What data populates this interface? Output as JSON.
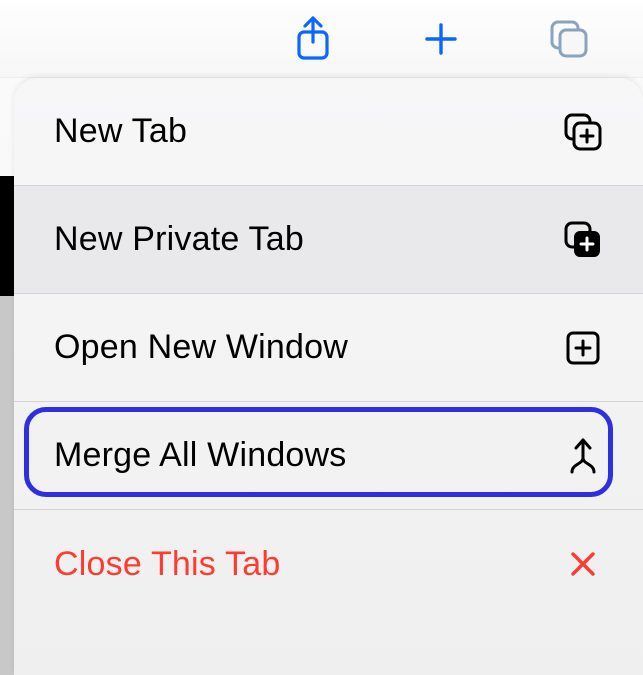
{
  "toolbar": {
    "share_icon": "share-icon",
    "add_icon": "plus-icon",
    "tabs_icon": "tabs-icon",
    "accent": "#0a66ff",
    "tabs_color": "#8aa3bf"
  },
  "menu": {
    "items": [
      {
        "label": "New Tab",
        "icon": "new-tab-icon",
        "style": "normal"
      },
      {
        "label": "New Private Tab",
        "icon": "new-private-tab-icon",
        "style": "highlight"
      },
      {
        "label": "Open New Window",
        "icon": "new-window-icon",
        "style": "normal"
      },
      {
        "label": "Merge All Windows",
        "icon": "merge-icon",
        "style": "normal"
      },
      {
        "label": "Close This Tab",
        "icon": "close-icon",
        "style": "danger"
      }
    ]
  },
  "highlight_color": "#2f2fe0",
  "danger_color": "#ff3b30"
}
